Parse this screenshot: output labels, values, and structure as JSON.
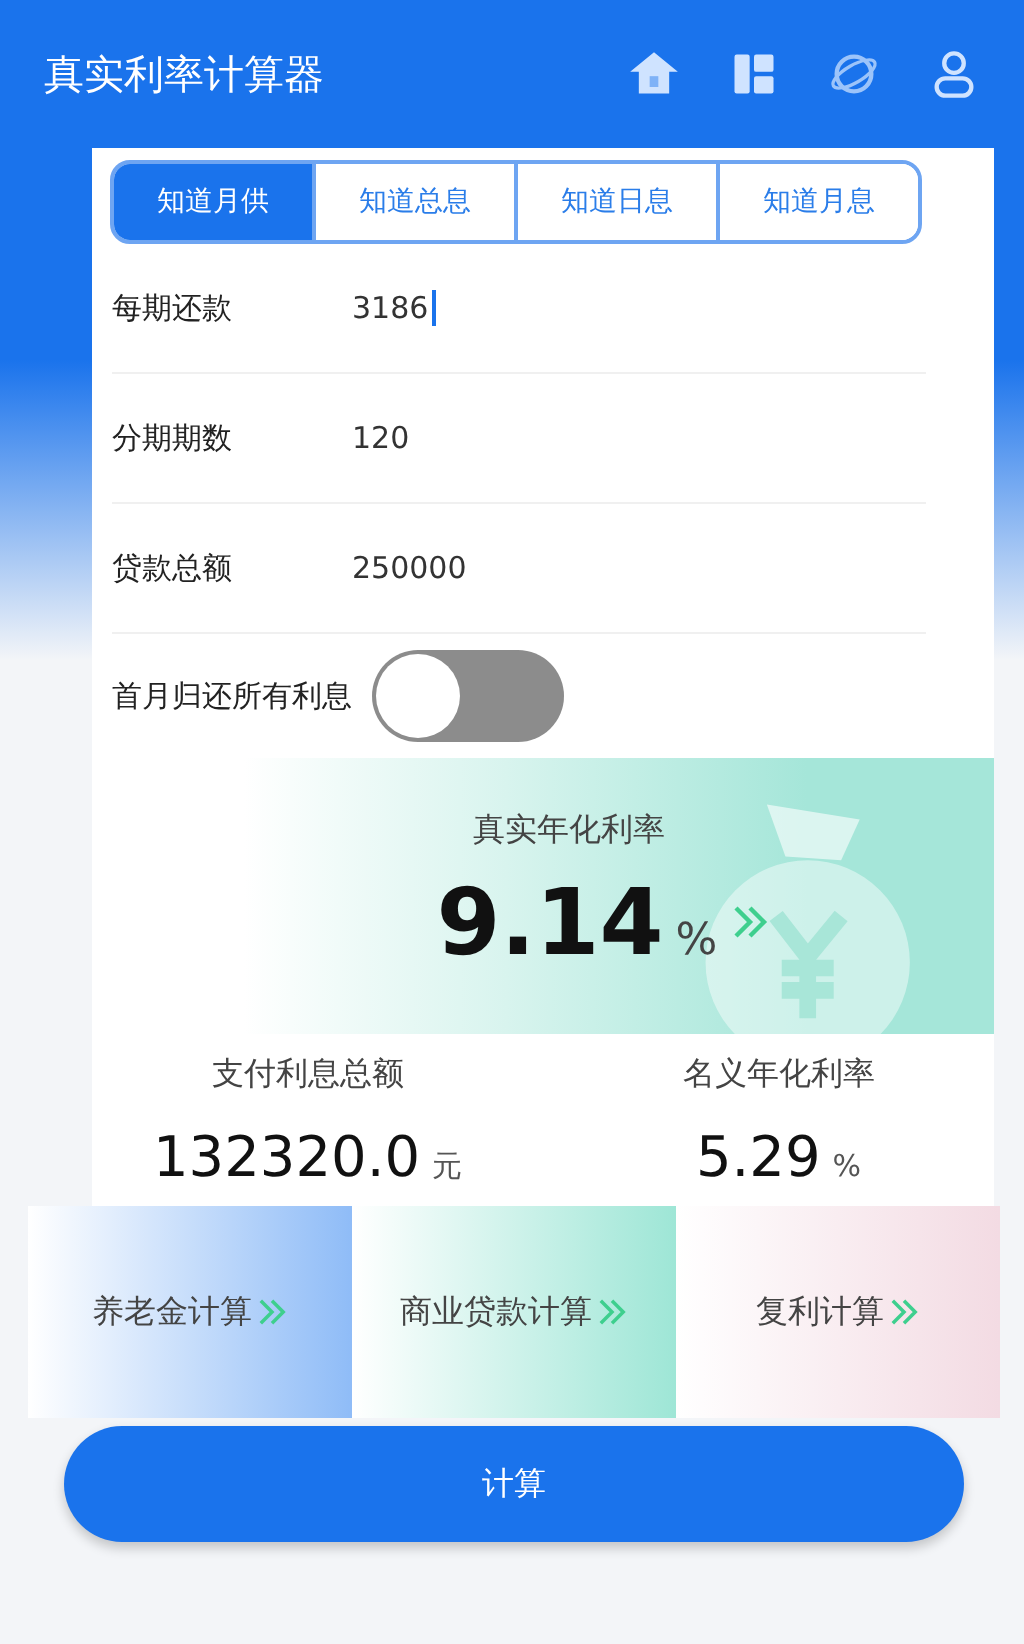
{
  "header": {
    "title": "真实利率计算器"
  },
  "tabs": [
    {
      "label": "知道月供",
      "selected": true
    },
    {
      "label": "知道总息",
      "selected": false
    },
    {
      "label": "知道日息",
      "selected": false
    },
    {
      "label": "知道月息",
      "selected": false
    }
  ],
  "fields": [
    {
      "label": "每期还款",
      "value": "3186",
      "focused": true
    },
    {
      "label": "分期期数",
      "value": "120",
      "focused": false
    },
    {
      "label": "贷款总额",
      "value": "250000",
      "focused": false
    }
  ],
  "toggle": {
    "label": "首月归还所有利息",
    "on": false
  },
  "result": {
    "title": "真实年化利率",
    "value": "9.14",
    "unit": "%"
  },
  "summary": [
    {
      "label": "支付利息总额",
      "value": "132320.0",
      "unit": "元"
    },
    {
      "label": "名义年化利率",
      "value": "5.29",
      "unit": "%"
    }
  ],
  "shortcuts": [
    {
      "label": "养老金计算",
      "color": "#8fbcf7"
    },
    {
      "label": "商业贷款计算",
      "color": "#9ee6d6"
    },
    {
      "label": "复利计算",
      "color": "#f3dbe3"
    }
  ],
  "calculate_button": {
    "label": "计算"
  }
}
